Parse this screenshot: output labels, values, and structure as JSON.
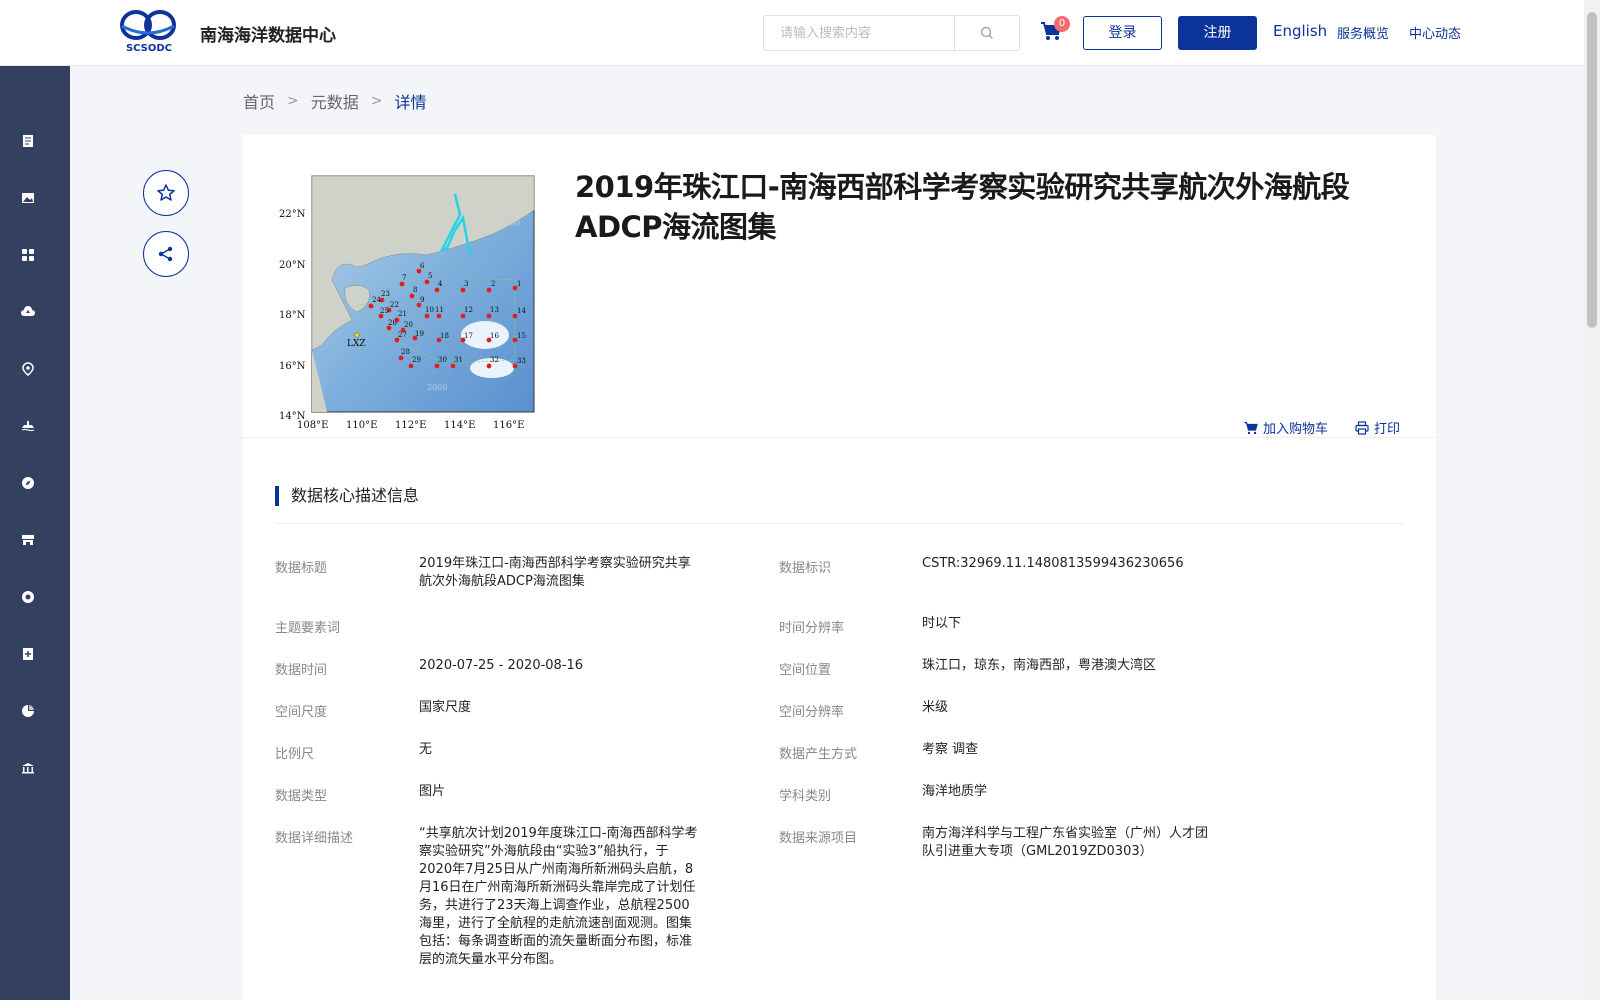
{
  "header": {
    "site_title": "南海海洋数据中心",
    "logo_text": "SCSODC",
    "search_placeholder": "请输入搜索内容",
    "cart_count": "0",
    "login_label": "登录",
    "register_label": "注册",
    "nav": [
      "English",
      "服务概览",
      "中心动态"
    ],
    "brand_color": "#0c3399"
  },
  "breadcrumb": [
    "首页",
    "元数据",
    "详情"
  ],
  "dataset": {
    "title": "2019年珠江口-南海西部科学考察实验研究共享航次外海航段ADCP海流图集",
    "add_to_cart": "加入购物车",
    "print": "打印"
  },
  "map": {
    "lat_labels": [
      "22°N",
      "20°N",
      "18°N",
      "16°N",
      "14°N"
    ],
    "lon_labels": [
      "108°E",
      "110°E",
      "112°E",
      "114°E",
      "116°E"
    ],
    "contours": [
      "200",
      "2000"
    ],
    "station_label": "LXZ",
    "stations": [
      "1",
      "2",
      "3",
      "4",
      "5",
      "6",
      "7",
      "8",
      "9",
      "10",
      "11",
      "12",
      "13",
      "14",
      "15",
      "16",
      "17",
      "18",
      "19",
      "20",
      "21",
      "22",
      "23",
      "24",
      "25",
      "26",
      "27",
      "28",
      "29",
      "30",
      "31",
      "32",
      "33"
    ]
  },
  "section": {
    "title": "数据核心描述信息"
  },
  "fields": {
    "title_label": "数据标题",
    "title_value": "2019年珠江口-南海西部科学考察实验研究共享航次外海航段ADCP海流图集",
    "id_label": "数据标识",
    "id_value": "CSTR:32969.11.1480813599436230656",
    "keywords_label": "主题要素词",
    "keywords_value": "",
    "time_res_label": "时间分辨率",
    "time_res_value": "时以下",
    "time_label": "数据时间",
    "time_value": "2020-07-25 - 2020-08-16",
    "location_label": "空间位置",
    "location_value": "珠江口，琼东，南海西部，粤港澳大湾区",
    "scale_label": "空间尺度",
    "scale_value": "国家尺度",
    "space_res_label": "空间分辨率",
    "space_res_value": "米级",
    "ratio_label": "比例尺",
    "ratio_value": "无",
    "method_label": "数据产生方式",
    "method_value": "考察 调查",
    "type_label": "数据类型",
    "type_value": "图片",
    "discipline_label": "学科类别",
    "discipline_value": "海洋地质学",
    "desc_label": "数据详细描述",
    "desc_value": "“共享航次计划2019年度珠江口-南海西部科学考察实验研究”外海航段由“实验3”船执行，于2020年7月25日从广州南海所新洲码头启航，8月16日在广州南海所新洲码头靠岸完成了计划任务，共进行了23天海上调查作业，总航程2500海里，进行了全航程的走航流速剖面观测。图集包括：每条调查断面的流矢量断面分布图，标准层的流矢量水平分布图。",
    "source_label": "数据来源项目",
    "source_value": "南方海洋科学与工程广东省实验室（广州）人才团队引进重大专项（GML2019ZD0303）"
  }
}
